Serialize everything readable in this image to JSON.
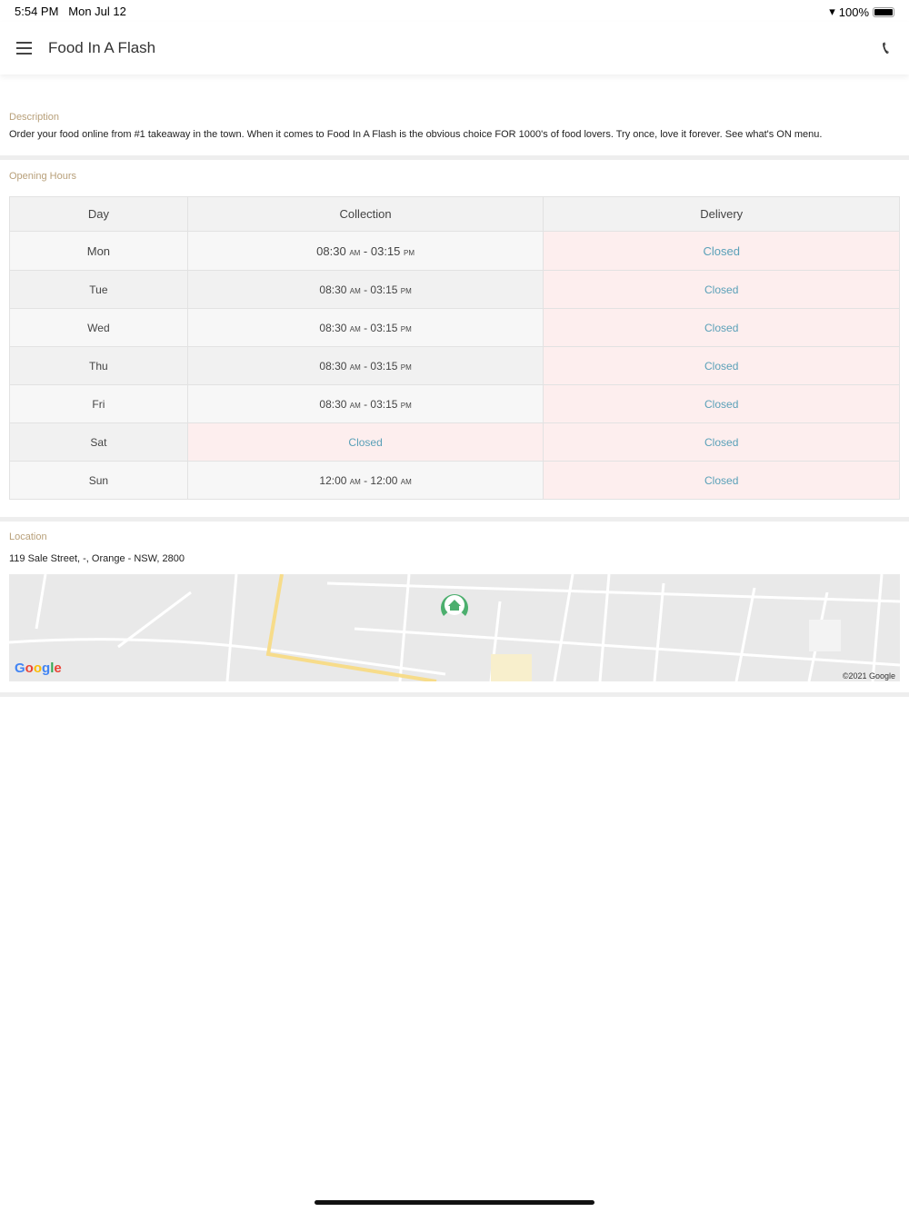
{
  "status": {
    "time": "5:54 PM",
    "date": "Mon Jul 12",
    "battery": "100%"
  },
  "header": {
    "title": "Food In A Flash"
  },
  "description": {
    "label": "Description",
    "text": "Order your food online from #1 takeaway in the town. When it comes to Food In A Flash is the obvious choice FOR 1000's of food lovers. Try once, love it forever. See what's ON menu."
  },
  "hours": {
    "label": "Opening Hours",
    "columns": [
      "Day",
      "Collection",
      "Delivery"
    ],
    "rows": [
      {
        "day": "Mon",
        "collection": "08:30 AM - 03:15 PM",
        "delivery": "Closed"
      },
      {
        "day": "Tue",
        "collection": "08:30 AM - 03:15 PM",
        "delivery": "Closed"
      },
      {
        "day": "Wed",
        "collection": "08:30 AM - 03:15 PM",
        "delivery": "Closed"
      },
      {
        "day": "Thu",
        "collection": "08:30 AM - 03:15 PM",
        "delivery": "Closed"
      },
      {
        "day": "Fri",
        "collection": "08:30 AM - 03:15 PM",
        "delivery": "Closed"
      },
      {
        "day": "Sat",
        "collection": "Closed",
        "delivery": "Closed"
      },
      {
        "day": "Sun",
        "collection": "12:00 AM - 12:00 AM",
        "delivery": "Closed"
      }
    ]
  },
  "location": {
    "label": "Location",
    "address": "119 Sale Street, -, Orange - NSW, 2800",
    "map_logo": "Google",
    "map_copyright": "©2021 Google"
  }
}
